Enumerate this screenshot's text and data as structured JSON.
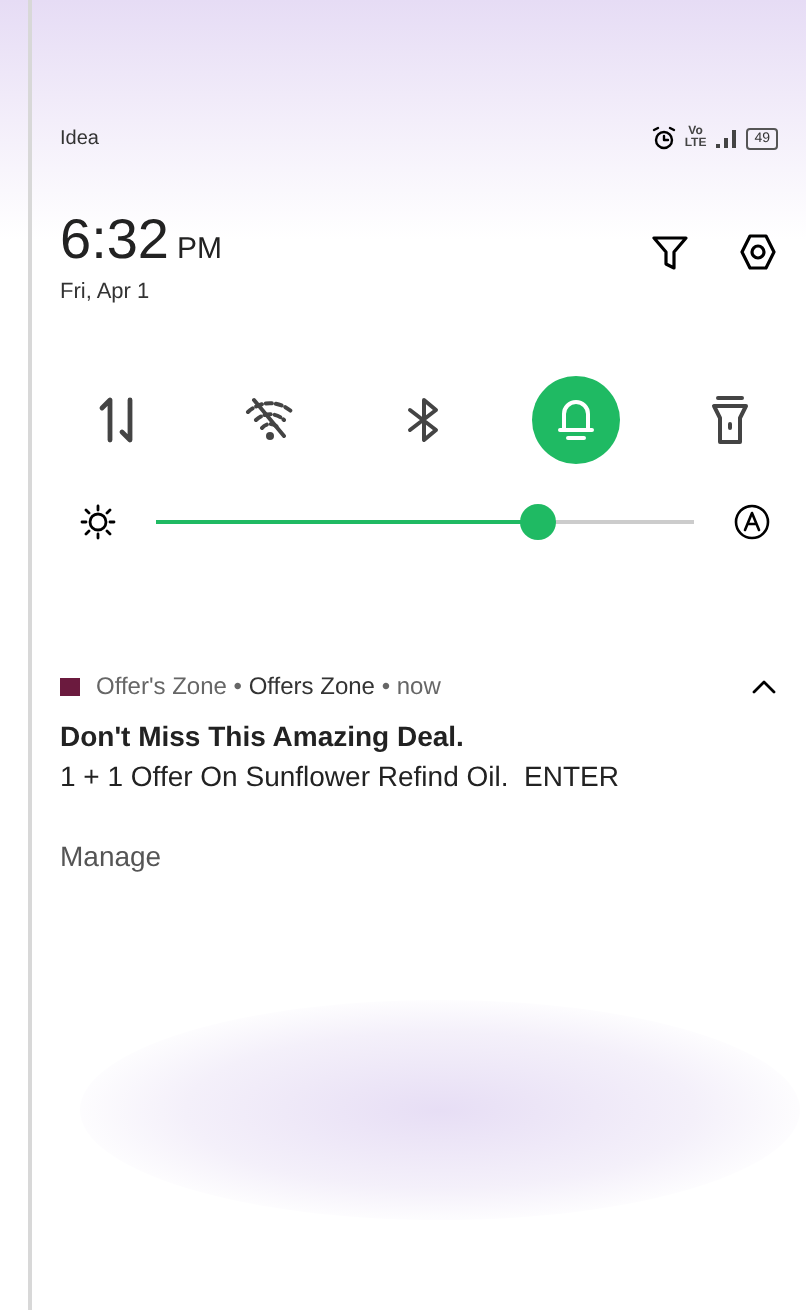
{
  "status_bar": {
    "carrier": "Idea",
    "network_label": "Vo\nLTE",
    "battery": "49"
  },
  "header": {
    "time": "6:32",
    "meridiem": "PM",
    "date": "Fri, Apr 1"
  },
  "tiles": [
    {
      "kind": "data",
      "on": false
    },
    {
      "kind": "wifi",
      "on": false
    },
    {
      "kind": "bluetooth",
      "on": false
    },
    {
      "kind": "bell",
      "on": true
    },
    {
      "kind": "flashlight",
      "on": false
    }
  ],
  "brightness": {
    "level": 0.71
  },
  "notification": {
    "app": "Offer's Zone",
    "channel": "Offers Zone",
    "time": "now",
    "separator": "•",
    "title": "Don't Miss This Amazing Deal.",
    "body": "1 + 1 Offer On Sunflower Refind Oil.  ENTER",
    "expanded": true
  },
  "manage": "Manage"
}
